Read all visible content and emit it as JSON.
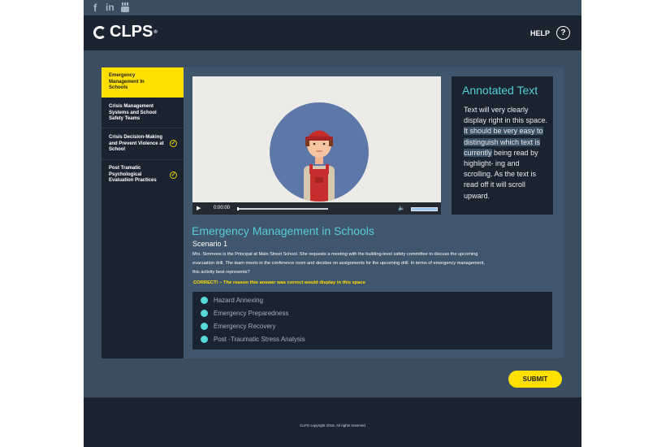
{
  "social": [
    "facebook-icon",
    "linkedin-icon",
    "youtube-icon"
  ],
  "header": {
    "logo": "CLPS",
    "help_label": "HELP",
    "help_icon": "?"
  },
  "sidebar": {
    "items": [
      {
        "label": "Emergency Management In Schools",
        "active": true,
        "complete": false
      },
      {
        "label": "Crisis Management Systems and School Safety Teams",
        "active": false,
        "complete": false
      },
      {
        "label": "Crisis Decision-Making and Prevent Violence at School",
        "active": false,
        "complete": true
      },
      {
        "label": "Post Tramatic Psychological Evaluation Practices",
        "active": false,
        "complete": true
      }
    ]
  },
  "video": {
    "time": "0:00:00",
    "progress": 0.02,
    "volume": 1.0
  },
  "annotated": {
    "title": "Annotated Text",
    "text_before": "Text will very clearly display right in this space.",
    "text_highlight": "It should be very easy to distinguish which text is currently",
    "text_after": "being read by highlight- ing and scrolling. As the text is read off it will scroll upward."
  },
  "content": {
    "title": "Emergency Management in Schools",
    "scenario": "Scenario 1",
    "description": "Mrs. Simmons is the Principal at Main Street School. She requests a meeting with the building-level safety committee to discuss the upcoming evacuation drill. The team meets in the conference room and decides on assignments for the upcoming drill. In terms of emergency management, this activity best represents?",
    "feedback": "CORRECT! – The reason this answer was correct would display in this space",
    "answers": [
      "Hazard Annexing",
      "Emergency Preparedness",
      "Emergency Recovery",
      "Post -Traumatic Stress Analysis"
    ]
  },
  "submit_label": "SUBMIT",
  "footer": {
    "copyright": "CLPS copyright 2016, All rights reserved"
  },
  "colors": {
    "accent_yellow": "#ffe000",
    "accent_cyan": "#56ccd7",
    "dark_navy": "#1a2431",
    "panel": "#40566c"
  }
}
